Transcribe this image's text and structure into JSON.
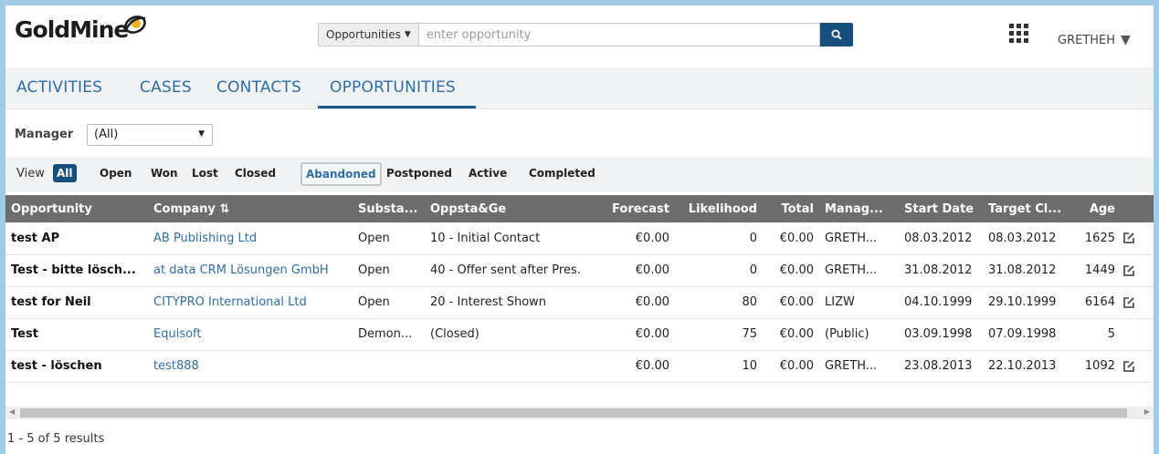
{
  "header": {
    "logo_text": "GoldMine",
    "logo_reg": "®",
    "search_scope": "Opportunities",
    "search_placeholder": "enter opportunity",
    "username": "GRETHEH",
    "user_menu_icon": "caret-down-icon"
  },
  "nav": {
    "tabs": [
      {
        "label": "ACTIVITIES"
      },
      {
        "label": "CASES"
      },
      {
        "label": "CONTACTS"
      },
      {
        "label": "OPPORTUNITIES",
        "active": true
      }
    ]
  },
  "manager": {
    "label": "Manager",
    "selected": "(All)"
  },
  "view": {
    "label": "View",
    "filters": [
      "All",
      "Open",
      "Won",
      "Lost",
      "Closed",
      "Abandoned",
      "Postponed",
      "Active",
      "Completed"
    ],
    "active": "All",
    "focused": "Abandoned"
  },
  "table": {
    "columns": [
      "Opportunity",
      "Company",
      "Substa...",
      "Oppsta&Ge",
      "Forecast",
      "Likelihood",
      "Total",
      "Manag...",
      "Start Date",
      "Target Cl...",
      "Age"
    ],
    "sort_icon": "sort-icon",
    "rows": [
      {
        "opportunity": "test AP",
        "company": "AB Publishing Ltd",
        "substage": "Open",
        "stage": "10 - Initial Contact",
        "forecast": "€0.00",
        "likelihood": "0",
        "total": "€0.00",
        "manager": "GRETH...",
        "start": "08.03.2012",
        "target": "08.03.2012",
        "age": "1625",
        "editable": true
      },
      {
        "opportunity": "Test - bitte lösch...",
        "company": "at data CRM Lösungen GmbH",
        "substage": "Open",
        "stage": "40 - Offer sent after Pres.",
        "forecast": "€0.00",
        "likelihood": "0",
        "total": "€0.00",
        "manager": "GRETH...",
        "start": "31.08.2012",
        "target": "31.08.2012",
        "age": "1449",
        "editable": true
      },
      {
        "opportunity": "test for Neil",
        "company": "CITYPRO International Ltd",
        "substage": "Open",
        "stage": "20 - Interest Shown",
        "forecast": "€0.00",
        "likelihood": "80",
        "total": "€0.00",
        "manager": "LIZW",
        "start": "04.10.1999",
        "target": "29.10.1999",
        "age": "6164",
        "editable": true
      },
      {
        "opportunity": "Test",
        "company": "Equisoft",
        "substage": "Demon...",
        "stage": "(Closed)",
        "forecast": "€0.00",
        "likelihood": "75",
        "total": "€0.00",
        "manager": "(Public)",
        "start": "03.09.1998",
        "target": "07.09.1998",
        "age": "5",
        "editable": false
      },
      {
        "opportunity": "test - löschen",
        "company": "test888",
        "substage": "",
        "stage": "",
        "forecast": "€0.00",
        "likelihood": "10",
        "total": "€0.00",
        "manager": "GRETH...",
        "start": "23.08.2013",
        "target": "22.10.2013",
        "age": "1092",
        "editable": true
      }
    ]
  },
  "footer": {
    "results": "1 - 5 of 5 results"
  },
  "colors": {
    "brand_blue": "#164f7e",
    "link_blue": "#2f6ea5",
    "header_gray": "#6d6d6d",
    "page_border": "#9fcbe6"
  }
}
